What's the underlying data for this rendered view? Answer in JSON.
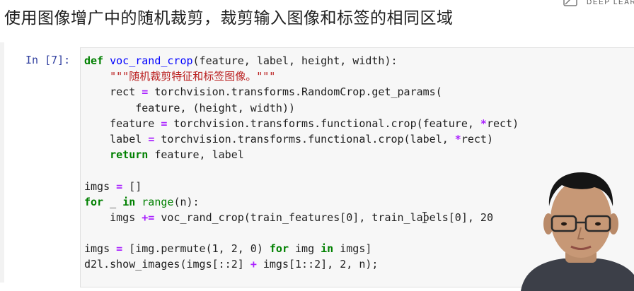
{
  "slide": {
    "title": "使用图像增广中的随机裁剪，裁剪输入图像和标签的相同区域",
    "logo_text": "DEEP LEARN"
  },
  "cell": {
    "prompt": "In [7]:",
    "code": {
      "l1": {
        "kw": "def",
        "space": " ",
        "fn": "voc_rand_crop",
        "rest": "(feature, label, height, width):"
      },
      "l2": {
        "indent": "    ",
        "doc": "\"\"\"随机裁剪特征和标签图像。\"\"\""
      },
      "l3": {
        "indent": "    ",
        "a": "rect ",
        "op": "=",
        "b": " torchvision.transforms.RandomCrop.get_params("
      },
      "l4": {
        "indent": "        ",
        "a": "feature, (height, width))"
      },
      "l5": {
        "indent": "    ",
        "a": "feature ",
        "op1": "=",
        "b": " torchvision.transforms.functional.crop(feature, ",
        "op2": "*",
        "c": "rect)"
      },
      "l6": {
        "indent": "    ",
        "a": "label ",
        "op1": "=",
        "b": " torchvision.transforms.functional.crop(label, ",
        "op2": "*",
        "c": "rect)"
      },
      "l7": {
        "indent": "    ",
        "kw": "return",
        "b": " feature, label"
      },
      "l9": {
        "a": "imgs ",
        "op": "=",
        "b": " []"
      },
      "l10": {
        "kw1": "for",
        "a": " _ ",
        "kw2": "in",
        "space": " ",
        "bi": "range",
        "b": "(n):"
      },
      "l11": {
        "indent": "    ",
        "a": "imgs ",
        "op": "+=",
        "b": " voc_rand_crop(train_features[0], train_labels[0], 20"
      },
      "l13": {
        "a": "imgs ",
        "op": "=",
        "b": " [img.permute(1, 2, 0) ",
        "kw1": "for",
        "c": " img ",
        "kw2": "in",
        "d": " imgs]"
      },
      "l14": {
        "a": "d2l.show_images(imgs[::2] ",
        "op": "+",
        "b": " imgs[1::2], 2, n);"
      }
    }
  },
  "colors": {
    "keyword": "#008000",
    "function": "#0000ff",
    "string": "#ba2121",
    "operator": "#aa22ff",
    "prompt": "#303f9f",
    "code_bg": "#f7f7f7"
  },
  "icons": {
    "logo": "deep-learning-logo-icon",
    "cursor": "text-cursor-icon",
    "presenter": "presenter-video"
  }
}
